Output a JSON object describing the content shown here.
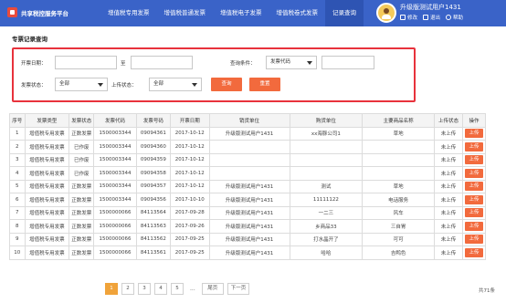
{
  "header": {
    "brand": "共享税控服务平台",
    "nav": [
      "增值税专用发票",
      "增值税普通发票",
      "增值税电子发票",
      "增值税卷式发票",
      "记录查询"
    ],
    "user_name": "升级版测试用户1431",
    "links": [
      "修改",
      "退出",
      "帮助"
    ]
  },
  "page_title": "专票记录查询",
  "search": {
    "date_label": "开票日期：",
    "date_from": "",
    "date_sep": "至",
    "date_to": "",
    "query_label": "查询条件：",
    "query_select": "发票代码",
    "query_value": "",
    "invoice_status_label": "发票状态：",
    "invoice_status": "全部",
    "upload_status_label": "上传状态：",
    "upload_status": "全部",
    "search_button": "查询",
    "reset_button": "重置"
  },
  "table": {
    "headers": [
      "序号",
      "发票类型",
      "发票状态",
      "发票代码",
      "发票号码",
      "开票日期",
      "销货单位",
      "购货单位",
      "主要商品名称",
      "上传状态",
      "操作"
    ],
    "rows": [
      [
        "1",
        "增值税专用发票",
        "正数发票",
        "1500003344",
        "09094361",
        "2017-10-12",
        "升级版测试用户1431",
        "xx海豚公司1",
        "草地",
        "未上传",
        "上传"
      ],
      [
        "2",
        "增值税专用发票",
        "已作废",
        "1500003344",
        "09094360",
        "2017-10-12",
        "",
        "",
        "",
        "未上传",
        "上传"
      ],
      [
        "3",
        "增值税专用发票",
        "已作废",
        "1500003344",
        "09094359",
        "2017-10-12",
        "",
        "",
        "",
        "未上传",
        "上传"
      ],
      [
        "4",
        "增值税专用发票",
        "已作废",
        "1500003344",
        "09094358",
        "2017-10-12",
        "",
        "",
        "",
        "未上传",
        "上传"
      ],
      [
        "5",
        "增值税专用发票",
        "正数发票",
        "1500003344",
        "09094357",
        "2017-10-12",
        "升级版测试用户1431",
        "测试",
        "草地",
        "未上传",
        "上传"
      ],
      [
        "6",
        "增值税专用发票",
        "正数发票",
        "1500003344",
        "09094356",
        "2017-10-10",
        "升级版测试用户1431",
        "11111122",
        "电话服务",
        "未上传",
        "上传"
      ],
      [
        "7",
        "增值税专用发票",
        "正数发票",
        "1500000066",
        "84113564",
        "2017-09-28",
        "升级版测试用户1431",
        "一二三",
        "风车",
        "未上传",
        "上传"
      ],
      [
        "8",
        "增值税专用发票",
        "正数发票",
        "1500000066",
        "84113563",
        "2017-09-26",
        "升级版测试用户1431",
        "乡商品33",
        "三自胃",
        "未上传",
        "上传"
      ],
      [
        "9",
        "增值税专用发票",
        "正数发票",
        "1500000066",
        "84113562",
        "2017-09-25",
        "升级版测试用户1431",
        "打水晶开了",
        "可可",
        "未上传",
        "上传"
      ],
      [
        "10",
        "增值税专用发票",
        "正数发票",
        "1500000066",
        "84113561",
        "2017-09-25",
        "升级版测试用户1431",
        "哈哈",
        "吉鸭色",
        "未上传",
        "上传"
      ]
    ]
  },
  "pagination": {
    "pages": [
      "1",
      "2",
      "3",
      "4",
      "5"
    ],
    "ellipsis": "...",
    "last": "尾页",
    "next": "下一页",
    "total": "共71条"
  },
  "colors": {
    "header_bg": "#3a63c8",
    "accent": "#f26a3d",
    "panel_border": "#e8323c",
    "status_text": "#e8323c",
    "active_page": "#f0a33a"
  },
  "icons": [
    "brand-logo-icon",
    "user-avatar-icon",
    "edit-icon",
    "logout-icon",
    "help-icon",
    "chevron-down-icon"
  ]
}
